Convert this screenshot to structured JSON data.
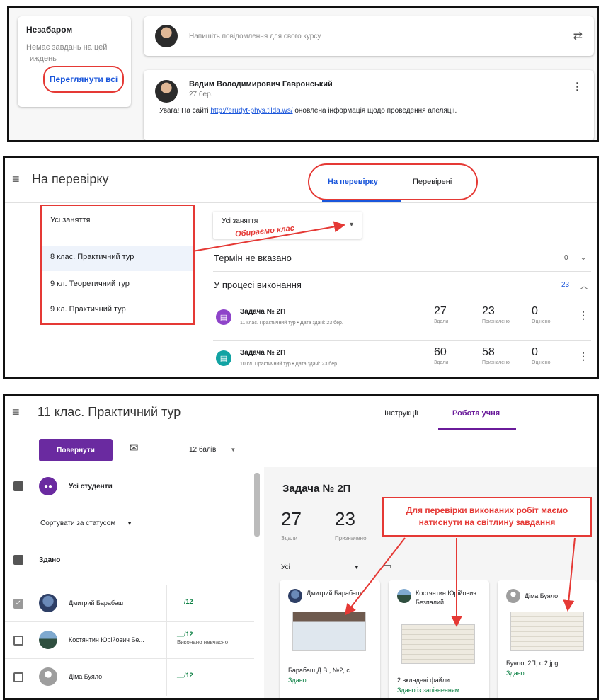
{
  "panel1": {
    "upcoming_title": "Незабаром",
    "upcoming_empty": "Немає завдань на цей тиждень",
    "view_all": "Переглянути всі",
    "post_placeholder": "Напишіть повідомлення для свого курсу",
    "post": {
      "author": "Вадим Володимирович Гавронський",
      "date": "27 бер.",
      "text_before": "Увага! На сайті ",
      "link": "http://erudyt-phys.tilda.ws/",
      "text_after": " оновлена інформація щодо проведення апеляції."
    }
  },
  "panel2": {
    "title": "На перевірку",
    "tabs": [
      "На перевірку",
      "Перевірені"
    ],
    "dropdown_open": {
      "header": "Усі заняття",
      "options": [
        "8 клас. Практичний тур",
        "9 кл. Теоретичний тур",
        "9 кл. Практичний тур"
      ]
    },
    "dropdown_closed_value": "Усі заняття",
    "annotation": "Обираємо клас",
    "sections": [
      {
        "title": "Термін не вказано",
        "count": "0"
      },
      {
        "title": "У процесі виконання",
        "count": "23"
      }
    ],
    "tasks": [
      {
        "title": "Задача № 2П",
        "sub": "11 клас. Практичний тур • Дата здачі: 23 бер.",
        "turned_in": "27",
        "assigned": "23",
        "graded": "0",
        "color": "#8e44c9"
      },
      {
        "title": "Задача № 2П",
        "sub": "10 кл. Практичний тур • Дата здачі: 23 бер.",
        "turned_in": "60",
        "assigned": "58",
        "graded": "0",
        "color": "#12a3a3"
      }
    ],
    "stat_labels": {
      "turned_in": "Здали",
      "assigned": "Призначено",
      "graded": "Оцінено"
    }
  },
  "panel3": {
    "title": "11 клас. Практичний тур",
    "tabs": [
      "Інструкції",
      "Робота учня"
    ],
    "return_button": "Повернути",
    "points": "12 балів",
    "all_students": "Усі студенти",
    "sort_label": "Сортувати за статусом",
    "group_label": "Здано",
    "students": [
      {
        "name": "Дмитрий Барабаш",
        "grade": "__/12",
        "note": "",
        "checked": true
      },
      {
        "name": "Костянтин Юрійович Бе...",
        "grade": "__/12",
        "note": "Виконано невчасно",
        "checked": false
      },
      {
        "name": "Діма Буяло",
        "grade": "__/12",
        "note": "",
        "checked": false
      }
    ],
    "assignment_title": "Задача № 2П",
    "turned_in": "27",
    "turned_in_label": "Здали",
    "assigned": "23",
    "assigned_label": "Призначено",
    "filter": "Усі",
    "cards": [
      {
        "name": "Дмитрий Барабаш",
        "file": "Барабаш Д.В., №2, с...",
        "status": "Здано"
      },
      {
        "name": "Костянтин Юрійович Безпалий",
        "file": "2 вкладені файли",
        "status": "Здано із запізненням"
      },
      {
        "name": "Діма Буяло",
        "file": "Буяло, 2П, с.2.jpg",
        "status": "Здано"
      }
    ],
    "callout": "Для перевірки виконаних робіт маємо натиснути на світлину завдання"
  }
}
